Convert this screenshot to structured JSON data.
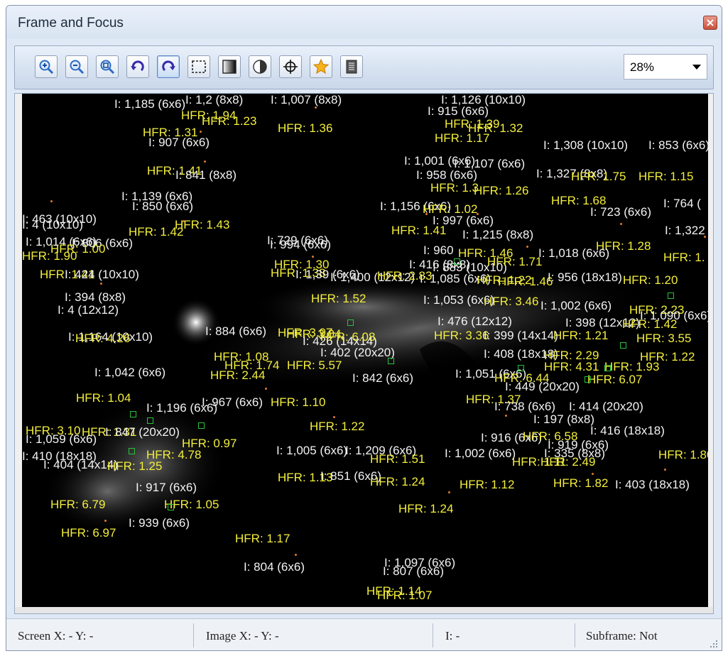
{
  "window": {
    "title": "Frame and Focus"
  },
  "toolbar": {
    "buttons": [
      {
        "name": "zoom-in",
        "icon": "magnifier-plus-icon",
        "active": false
      },
      {
        "name": "zoom-out",
        "icon": "magnifier-minus-icon",
        "active": false
      },
      {
        "name": "zoom-fit",
        "icon": "magnifier-fit-icon",
        "active": false
      },
      {
        "name": "rotate-left",
        "icon": "rotate-ccw-icon",
        "active": false
      },
      {
        "name": "rotate-right",
        "icon": "rotate-cw-icon",
        "active": true
      },
      {
        "name": "subframe",
        "icon": "dashed-rect-icon",
        "active": false
      },
      {
        "name": "stretch",
        "icon": "gradient-square-icon",
        "active": false
      },
      {
        "name": "contrast",
        "icon": "contrast-circle-icon",
        "active": false
      },
      {
        "name": "crosshair",
        "icon": "crosshair-icon",
        "active": false
      },
      {
        "name": "star-detect",
        "icon": "star-icon",
        "active": false
      },
      {
        "name": "fits-header",
        "icon": "document-icon",
        "active": false
      }
    ],
    "zoom": "28%"
  },
  "colors": {
    "hfr_text": "#f2ee3c",
    "intensity_text": "#f3f3f3",
    "star_box": "#28c33a",
    "background": "#000000"
  },
  "overlay": {
    "labels": [
      {
        "t": "I: 1,185 (6x6)",
        "c": "i"
      },
      {
        "t": "I: 1,2 (8x8)",
        "c": "i"
      },
      {
        "t": "I: 1,007 (8x8)",
        "c": "i"
      },
      {
        "t": "I: 1,126 (10x10)",
        "c": "i"
      },
      {
        "t": "I: 915 (6x6)",
        "c": "i"
      },
      {
        "t": "HFR: 1.94",
        "c": "h"
      },
      {
        "t": "HFR: 1.23",
        "c": "h"
      },
      {
        "t": "HFR: 1.36",
        "c": "h"
      },
      {
        "t": "HFR: 1.31",
        "c": "h"
      },
      {
        "t": "HFR: 1.39",
        "c": "h"
      },
      {
        "t": "HFR: 1.32",
        "c": "h"
      },
      {
        "t": "HFR: 1.17",
        "c": "h"
      },
      {
        "t": "I: 907 (6x6)",
        "c": "i"
      },
      {
        "t": "I: 1,308 (10x10)",
        "c": "i"
      },
      {
        "t": "I: 853 (6x6)",
        "c": "i"
      },
      {
        "t": "I: 1,001 (6x6)",
        "c": "i"
      },
      {
        "t": "I: 1,107 (6x6)",
        "c": "i"
      },
      {
        "t": "I: 958 (6x6)",
        "c": "i"
      },
      {
        "t": "I: 1,327 (8x8)",
        "c": "i"
      },
      {
        "t": "HFR: 1.75",
        "c": "h"
      },
      {
        "t": "HFR: 1.15",
        "c": "h"
      },
      {
        "t": "HFR: 1.41",
        "c": "h"
      },
      {
        "t": "I: 841 (8x8)",
        "c": "i"
      },
      {
        "t": "HFR: 1.3",
        "c": "h"
      },
      {
        "t": "HFR: 1.26",
        "c": "h"
      },
      {
        "t": "I: 1,139 (6x6)",
        "c": "i"
      },
      {
        "t": "I: 850 (6x6)",
        "c": "i"
      },
      {
        "t": "I: 1,156 (6x6)",
        "c": "i"
      },
      {
        "t": "HFR: 1.02",
        "c": "h"
      },
      {
        "t": "HFR: 1.68",
        "c": "h"
      },
      {
        "t": "I: 764 (",
        "c": "i"
      },
      {
        "t": "I: 723 (6x6)",
        "c": "i"
      },
      {
        "t": "I: 463 (10x10)",
        "c": "i"
      },
      {
        "t": "I: 4 (10x10)",
        "c": "i"
      },
      {
        "t": "HFR: 1.43",
        "c": "h"
      },
      {
        "t": "HFR: 1.42",
        "c": "h"
      },
      {
        "t": "I: 997 (6x6)",
        "c": "i"
      },
      {
        "t": "HFR: 1.41",
        "c": "h"
      },
      {
        "t": "I: 1,215 (8x8)",
        "c": "i"
      },
      {
        "t": "I: 1,322",
        "c": "i"
      },
      {
        "t": "I: 1,014 (6x6)",
        "c": "i"
      },
      {
        "t": "I: 806 (6x6)",
        "c": "i"
      },
      {
        "t": "I: 729 (6x6)",
        "c": "i"
      },
      {
        "t": "I: 994 (6x6)",
        "c": "i"
      },
      {
        "t": "HFR: 1.28",
        "c": "h"
      },
      {
        "t": "HFR: 1.00",
        "c": "h"
      },
      {
        "t": "I: 960",
        "c": "i"
      },
      {
        "t": "HFR: 1.46",
        "c": "h"
      },
      {
        "t": "I: 1,018 (6x6)",
        "c": "i"
      },
      {
        "t": "HFR: 1.90",
        "c": "h"
      },
      {
        "t": "HFR: 1.",
        "c": "h"
      },
      {
        "t": "I: 416 (8x8)",
        "c": "i"
      },
      {
        "t": "I: 883 (10x10)",
        "c": "i"
      },
      {
        "t": "HFR: 1.71",
        "c": "h"
      },
      {
        "t": "HFR: 1.30",
        "c": "h"
      },
      {
        "t": "HFR: 1.38",
        "c": "h"
      },
      {
        "t": "I: 1,39 (6x6)",
        "c": "i"
      },
      {
        "t": "HFR: 1.46",
        "c": "h"
      },
      {
        "t": "HFR: 1.41",
        "c": "h"
      },
      {
        "t": "I: 424 (10x10)",
        "c": "i"
      },
      {
        "t": "I: 1,400 (12x12)",
        "c": "i"
      },
      {
        "t": "HFR: 2.83",
        "c": "h"
      },
      {
        "t": "I: 1,085 (6x6)",
        "c": "i"
      },
      {
        "t": "HFR: 1.22",
        "c": "h"
      },
      {
        "t": "I: 956 (18x18)",
        "c": "i"
      },
      {
        "t": "HFR: 1.20",
        "c": "h"
      },
      {
        "t": "I: 394 (8x8)",
        "c": "i"
      },
      {
        "t": "HFR: 1.52",
        "c": "h"
      },
      {
        "t": "I: 1,053 (6x6)",
        "c": "i"
      },
      {
        "t": "I: 4 (12x12)",
        "c": "i"
      },
      {
        "t": "HFR: 3.46",
        "c": "h"
      },
      {
        "t": "I: 1,002 (6x6)",
        "c": "i"
      },
      {
        "t": "HFR: 2.23",
        "c": "h"
      },
      {
        "t": "I: 1,090 (6x6)",
        "c": "i"
      },
      {
        "t": "I: 884 (6x6)",
        "c": "i"
      },
      {
        "t": "HFR: 3.97",
        "c": "h"
      },
      {
        "t": "I: 476 (12x12)",
        "c": "i"
      },
      {
        "t": "I: 398 (12x12)",
        "c": "i"
      },
      {
        "t": "HFR: 1.42",
        "c": "h"
      },
      {
        "t": "I: 1,164 (10x10)",
        "c": "i"
      },
      {
        "t": "HFR: 4.26",
        "c": "h"
      },
      {
        "t": "HFR: 3.04",
        "c": "h"
      },
      {
        "t": "HFR: 3.36",
        "c": "h"
      },
      {
        "t": "I: 399 (14x14)",
        "c": "i"
      },
      {
        "t": "HFR: 1.21",
        "c": "h"
      },
      {
        "t": "HFR: 3.55",
        "c": "h"
      },
      {
        "t": "I: 426 (14x14)",
        "c": "i"
      },
      {
        "t": "HFR: 6.08",
        "c": "h"
      },
      {
        "t": "I: 402 (20x20)",
        "c": "i"
      },
      {
        "t": "I: 408 (18x18)",
        "c": "i"
      },
      {
        "t": "HFR: 2.29",
        "c": "h"
      },
      {
        "t": "HFR: 1.22",
        "c": "h"
      },
      {
        "t": "HFR: 1.08",
        "c": "h"
      },
      {
        "t": "HFR: 1.74",
        "c": "h"
      },
      {
        "t": "HFR: 5.57",
        "c": "h"
      },
      {
        "t": "HFR: 4.31",
        "c": "h"
      },
      {
        "t": "HFR: 1.93",
        "c": "h"
      },
      {
        "t": "I: 1,042 (6x6)",
        "c": "i"
      },
      {
        "t": "HFR: 2.44",
        "c": "h"
      },
      {
        "t": "I: 842 (6x6)",
        "c": "i"
      },
      {
        "t": "I: 1,051 (6x6)",
        "c": "i"
      },
      {
        "t": "HFR: 6.44",
        "c": "h"
      },
      {
        "t": "HFR: 6.07",
        "c": "h"
      },
      {
        "t": "I: 449 (20x20)",
        "c": "i"
      },
      {
        "t": "HFR: 1.04",
        "c": "h"
      },
      {
        "t": "I: 967 (6x6)",
        "c": "i"
      },
      {
        "t": "HFR: 1.10",
        "c": "h"
      },
      {
        "t": "HFR: 1.37",
        "c": "h"
      },
      {
        "t": "I: 738 (6x6)",
        "c": "i"
      },
      {
        "t": "I: 414 (20x20)",
        "c": "i"
      },
      {
        "t": "I: 1,196 (6x6)",
        "c": "i"
      },
      {
        "t": "I: 197 (8x8)",
        "c": "i"
      },
      {
        "t": "HFR: 3.10",
        "c": "h"
      },
      {
        "t": "HFR: 1.31",
        "c": "h"
      },
      {
        "t": "I: 847 (20x20)",
        "c": "i"
      },
      {
        "t": "HFR: 1.22",
        "c": "h"
      },
      {
        "t": "I: 416 (18x18)",
        "c": "i"
      },
      {
        "t": "I: 1,059 (6x6)",
        "c": "i"
      },
      {
        "t": "I: 916 (6x6)",
        "c": "i"
      },
      {
        "t": "HFR: 6.58",
        "c": "h"
      },
      {
        "t": "HFR: 0.97",
        "c": "h"
      },
      {
        "t": "I: 919 (6x6)",
        "c": "i"
      },
      {
        "t": "I: 1,005 (6x6)",
        "c": "i"
      },
      {
        "t": "I: 1,209 (6x6)",
        "c": "i"
      },
      {
        "t": "I: 1,002 (6x6)",
        "c": "i"
      },
      {
        "t": "I: 335 (8x8)",
        "c": "i"
      },
      {
        "t": "HFR: 1.80",
        "c": "h"
      },
      {
        "t": "I: 410 (18x18)",
        "c": "i"
      },
      {
        "t": "HFR: 4.78",
        "c": "h"
      },
      {
        "t": "HFR: 1.51",
        "c": "h"
      },
      {
        "t": "HFR: 1.11",
        "c": "h"
      },
      {
        "t": "HFR: 2.49",
        "c": "h"
      },
      {
        "t": "I: 404 (14x14)",
        "c": "i"
      },
      {
        "t": "HFR: 1.25",
        "c": "h"
      },
      {
        "t": "HFR: 1.13",
        "c": "h"
      },
      {
        "t": "I: 851 (6x6)",
        "c": "i"
      },
      {
        "t": "HFR: 1.24",
        "c": "h"
      },
      {
        "t": "HFR: 1.12",
        "c": "h"
      },
      {
        "t": "HFR: 1.82",
        "c": "h"
      },
      {
        "t": "I: 403 (18x18)",
        "c": "i"
      },
      {
        "t": "I: 917 (6x6)",
        "c": "i"
      },
      {
        "t": "HFR: 6.79",
        "c": "h"
      },
      {
        "t": "HFR: 1.05",
        "c": "h"
      },
      {
        "t": "HFR: 1.24",
        "c": "h"
      },
      {
        "t": "HFR: 6.97",
        "c": "h"
      },
      {
        "t": "I: 939 (6x6)",
        "c": "i"
      },
      {
        "t": "HFR: 1.17",
        "c": "h"
      },
      {
        "t": "I: 804 (6x6)",
        "c": "i"
      },
      {
        "t": "I: 1,097 (6x6)",
        "c": "i"
      },
      {
        "t": "I: 807 (6x6)",
        "c": "i"
      },
      {
        "t": "HFR: 1.14",
        "c": "h"
      },
      {
        "t": "HFR: 1.07",
        "c": "h"
      }
    ]
  },
  "statusbar": {
    "screen": "Screen X: - Y: -",
    "image": "Image X: - Y: -",
    "intensity": "I: -",
    "subframe": "Subframe: Not"
  }
}
